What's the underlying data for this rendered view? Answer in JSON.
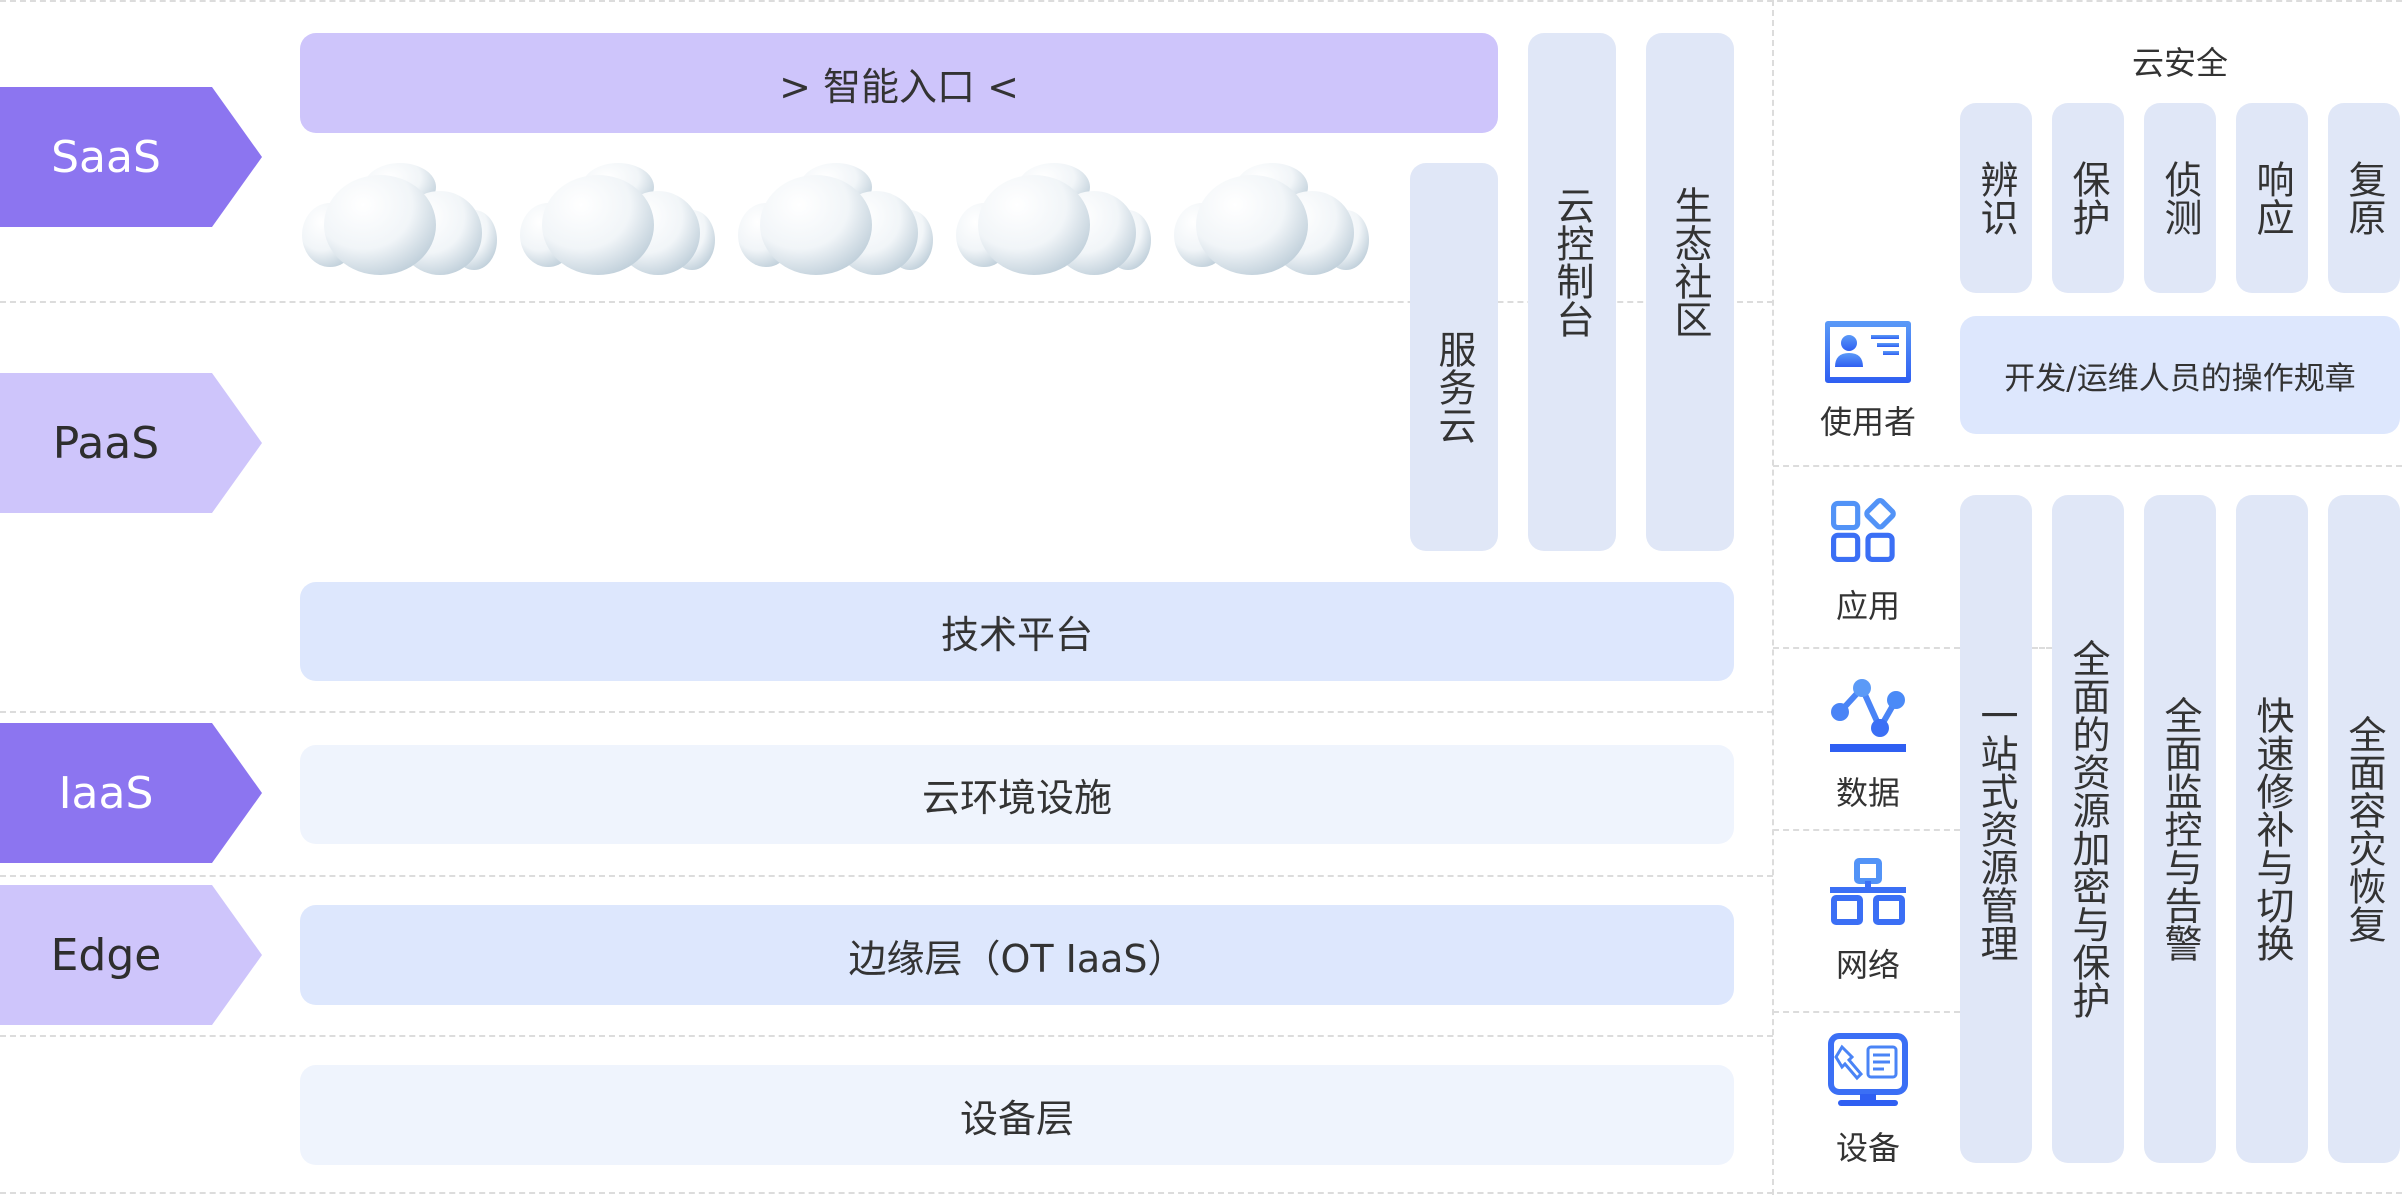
{
  "layers": {
    "saas": {
      "label": "SaaS",
      "style": "dark"
    },
    "paas": {
      "label": "PaaS",
      "style": "light"
    },
    "iaas": {
      "label": "IaaS",
      "style": "dark"
    },
    "edge": {
      "label": "Edge",
      "style": "light"
    }
  },
  "main": {
    "smart_entry": "> 智能入口 <",
    "clouds_count": 5,
    "service_cloud": "服务云",
    "cloud_console": "云控制台",
    "ecosystem": "生态社区",
    "tech_platform": "技术平台",
    "cloud_infra": "云环境设施",
    "edge_layer": "边缘层（OT IaaS）",
    "device_layer": "设备层"
  },
  "security": {
    "title": "云安全",
    "phases": [
      "辨识",
      "保护",
      "侦测",
      "响应",
      "复原"
    ],
    "user_rules": "开发/运维人员的操作规章",
    "subjects": [
      {
        "label": "使用者",
        "icon": "user-card-icon"
      },
      {
        "label": "应用",
        "icon": "apps-icon"
      },
      {
        "label": "数据",
        "icon": "data-chart-icon"
      },
      {
        "label": "网络",
        "icon": "network-icon"
      },
      {
        "label": "设备",
        "icon": "device-monitor-icon"
      }
    ],
    "capabilities": [
      "一站式资源管理",
      "全面的资源加密与保护",
      "全面监控与告警",
      "快速修补与切换",
      "全面容灾恢复"
    ]
  },
  "colors": {
    "tag_dark": "#8C75F0",
    "tag_light": "#CEC5FB",
    "box_blue": "#DDE7FD",
    "box_pale": "#EFF4FD",
    "column": "#E0E7F7",
    "icon_blue": "#3B6FF5"
  }
}
